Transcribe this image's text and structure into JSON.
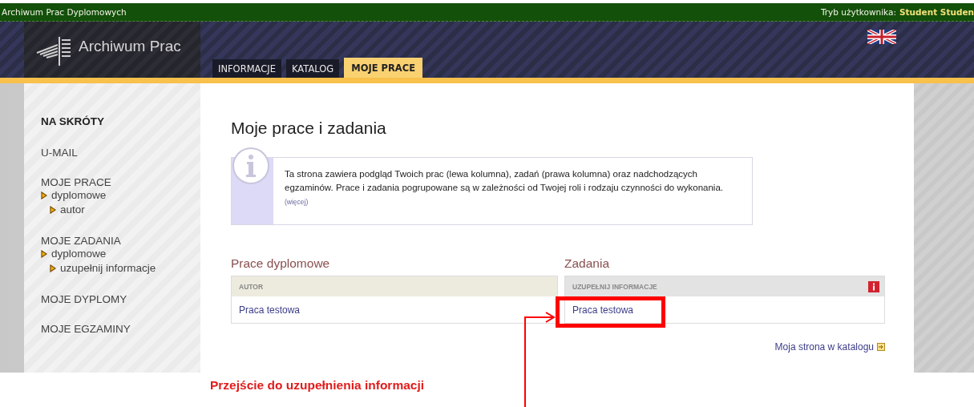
{
  "top_bar": {
    "title": "Archiwum Prac Dyplomowych",
    "user_mode_label": "Tryb użytkownika:",
    "user_name": "Student Studen"
  },
  "header": {
    "logo_text": "Archiwum Prac",
    "tabs": [
      {
        "label": "INFORMACJE",
        "selected": false
      },
      {
        "label": "KATALOG",
        "selected": false
      },
      {
        "label": "MOJE PRACE",
        "selected": true
      }
    ]
  },
  "sidebar": {
    "heading": "NA SKRÓTY",
    "sections": [
      {
        "label": "U-MAIL"
      },
      {
        "label": "MOJE PRACE",
        "children": [
          {
            "label": "dyplomowe",
            "children": [
              {
                "label": "autor"
              }
            ]
          }
        ]
      },
      {
        "label": "MOJE ZADANIA",
        "children": [
          {
            "label": "dyplomowe",
            "children": [
              {
                "label": "uzupełnij informacje"
              }
            ]
          }
        ]
      },
      {
        "label": "MOJE DYPLOMY"
      },
      {
        "label": "MOJE EGZAMINY"
      }
    ]
  },
  "page_title": "Moje prace i zadania",
  "info_box": {
    "text": "Ta strona zawiera podgląd Twoich prac (lewa kolumna), zadań (prawa kolumna) oraz nadchodzących egzaminów. Prace i zadania pogrupowane są w zależności od Twojej roli i rodzaju czynności do wykonania.",
    "more_link": "(więcej)"
  },
  "columns": [
    {
      "title": "Prace dyplomowe",
      "kind": "works",
      "group_header": "AUTOR",
      "alert": false,
      "rows": [
        {
          "label": "Praca testowa",
          "highlighted": false
        }
      ]
    },
    {
      "title": "Zadania",
      "kind": "tasks",
      "group_header": "UZUPEŁNIJ INFORMACJE",
      "alert": true,
      "rows": [
        {
          "label": "Praca testowa",
          "highlighted": true
        }
      ]
    }
  ],
  "catalog_link": "Moja strona w katalogu",
  "annotation": {
    "text": "Przejście do uzupełnienia informacji"
  }
}
